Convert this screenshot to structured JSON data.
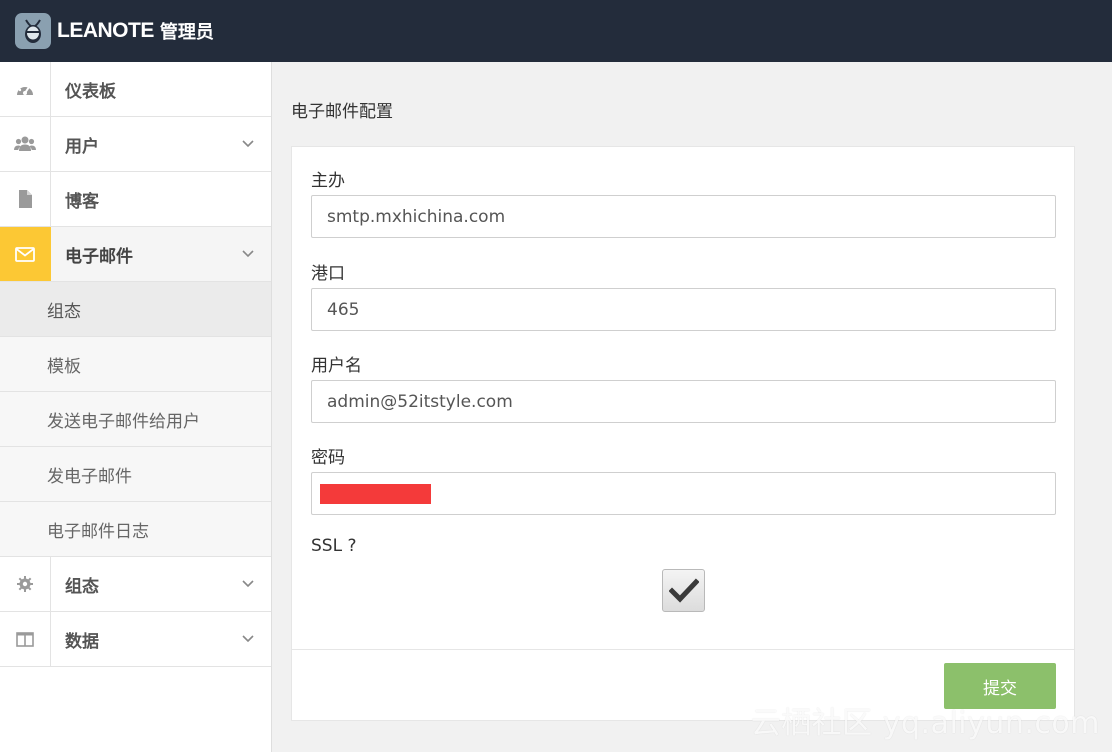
{
  "header": {
    "logo_text": "LEANOTE",
    "title_suffix": "管理员"
  },
  "sidebar": {
    "items": [
      {
        "label": "仪表板",
        "icon": "dashboard-icon"
      },
      {
        "label": "用户",
        "icon": "users-icon"
      },
      {
        "label": "博客",
        "icon": "file-icon"
      },
      {
        "label": "电子邮件",
        "icon": "envelope-icon"
      },
      {
        "label": "组态",
        "icon": "gear-icon"
      },
      {
        "label": "数据",
        "icon": "columns-icon"
      }
    ],
    "email_subitems": [
      "组态",
      "模板",
      "发送电子邮件给用户",
      "发电子邮件",
      "电子邮件日志"
    ],
    "accent_color": "#fcc834"
  },
  "main": {
    "page_title": "电子邮件配置",
    "form": {
      "host_label": "主办",
      "host_value": "smtp.mxhichina.com",
      "port_label": "港口",
      "port_value": "465",
      "username_label": "用户名",
      "username_value": "admin@52itstyle.com",
      "password_label": "密码",
      "ssl_label": "SSL ?",
      "ssl_checked": true,
      "submit_label": "提交"
    }
  },
  "watermark": "云栖社区 yq.aliyun.com"
}
